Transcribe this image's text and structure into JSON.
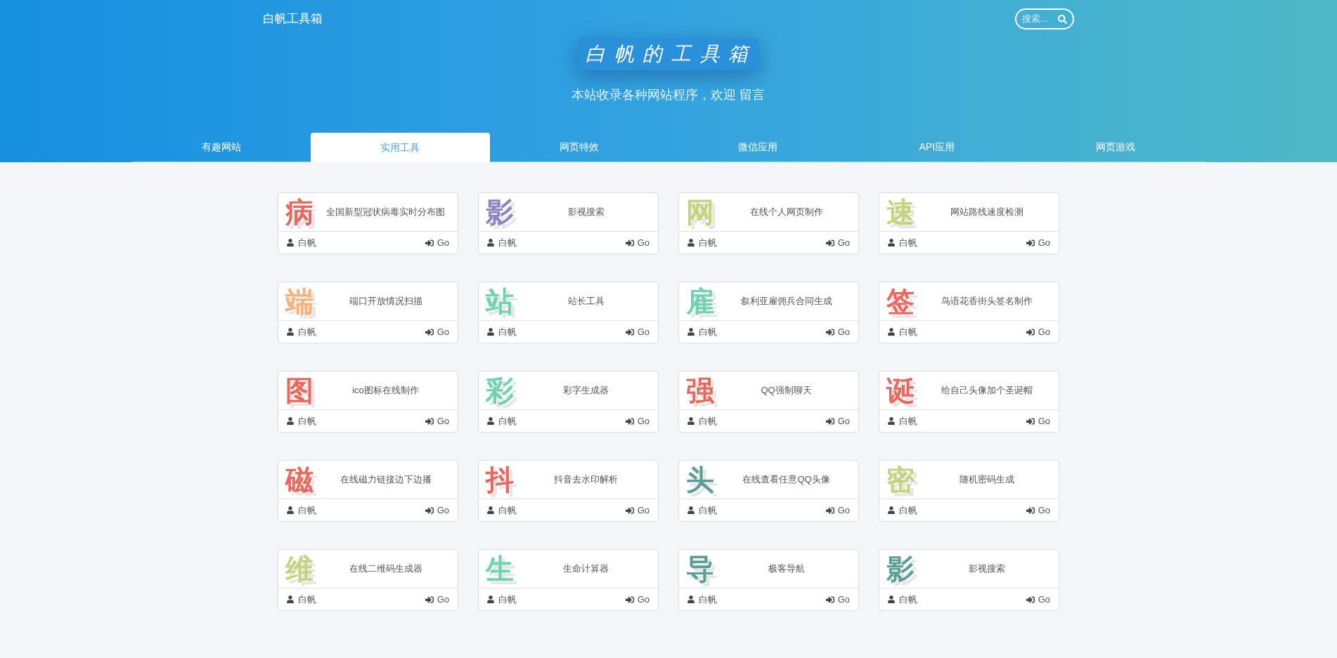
{
  "header": {
    "brand": "白帆工具箱",
    "search": {
      "placeholder": "搜索..."
    },
    "banner_title": "白帆的工具箱",
    "subtitle": "本站收录各种网站程序，欢迎 留言"
  },
  "tabs": [
    {
      "label": "有趣网站",
      "selected": false
    },
    {
      "label": "实用工具",
      "selected": true
    },
    {
      "label": "网页特效",
      "selected": false
    },
    {
      "label": "微信应用",
      "selected": false
    },
    {
      "label": "API应用",
      "selected": false
    },
    {
      "label": "网页游戏",
      "selected": false
    }
  ],
  "cards": [
    {
      "glyph": "病",
      "color": "#e8685e",
      "title": "全国新型冠状病毒实时分布图",
      "author": "白帆",
      "link": "Go"
    },
    {
      "glyph": "影",
      "color": "#8a84c5",
      "title": "影视搜索",
      "author": "白帆",
      "link": "Go"
    },
    {
      "glyph": "网",
      "color": "#c5d47a",
      "title": "在线个人网页制作",
      "author": "白帆",
      "link": "Go"
    },
    {
      "glyph": "速",
      "color": "#c5d47a",
      "title": "网站路线速度检测",
      "author": "白帆",
      "link": "Go"
    },
    {
      "glyph": "端",
      "color": "#f7b27a",
      "title": "端口开放情况扫描",
      "author": "白帆",
      "link": "Go"
    },
    {
      "glyph": "站",
      "color": "#6dd3b0",
      "title": "站长工具",
      "author": "白帆",
      "link": "Go"
    },
    {
      "glyph": "雇",
      "color": "#6dd3b0",
      "title": "叙利亚雇佣兵合同生成",
      "author": "白帆",
      "link": "Go"
    },
    {
      "glyph": "签",
      "color": "#e8685e",
      "title": "鸟语花香街头签名制作",
      "author": "白帆",
      "link": "Go"
    },
    {
      "glyph": "图",
      "color": "#e8685e",
      "title": "ico图标在线制作",
      "author": "白帆",
      "link": "Go"
    },
    {
      "glyph": "彩",
      "color": "#6dd3b0",
      "title": "彩字生成器",
      "author": "白帆",
      "link": "Go"
    },
    {
      "glyph": "强",
      "color": "#e8685e",
      "title": "QQ强制聊天",
      "author": "白帆",
      "link": "Go"
    },
    {
      "glyph": "诞",
      "color": "#e8685e",
      "title": "给自己头像加个圣诞帽",
      "author": "白帆",
      "link": "Go"
    },
    {
      "glyph": "磁",
      "color": "#e8685e",
      "title": "在线磁力链接边下边播",
      "author": "白帆",
      "link": "Go"
    },
    {
      "glyph": "抖",
      "color": "#e8685e",
      "title": "抖音去水印解析",
      "author": "白帆",
      "link": "Go"
    },
    {
      "glyph": "头",
      "color": "#5a9e9a",
      "title": "在线查看任意QQ头像",
      "author": "白帆",
      "link": "Go"
    },
    {
      "glyph": "密",
      "color": "#c5d47a",
      "title": "随机密码生成",
      "author": "白帆",
      "link": "Go"
    },
    {
      "glyph": "维",
      "color": "#c5d47a",
      "title": "在线二维码生成器",
      "author": "白帆",
      "link": "Go"
    },
    {
      "glyph": "生",
      "color": "#6dd3b0",
      "title": "生命计算器",
      "author": "白帆",
      "link": "Go"
    },
    {
      "glyph": "导",
      "color": "#5a9e9a",
      "title": "极客导航",
      "author": "白帆",
      "link": "Go"
    },
    {
      "glyph": "影",
      "color": "#5a9e9a",
      "title": "影视搜索",
      "author": "白帆",
      "link": "Go"
    }
  ]
}
